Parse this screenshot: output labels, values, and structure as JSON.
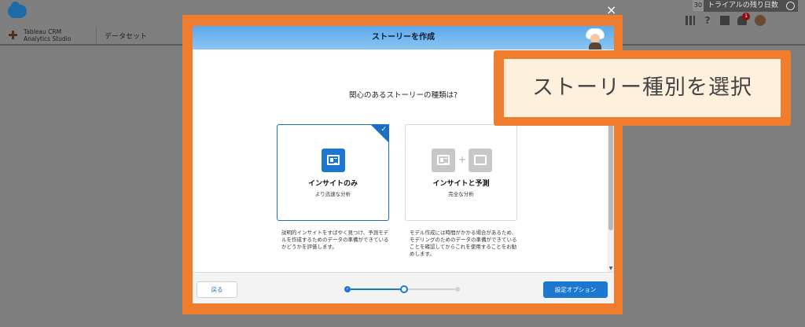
{
  "header": {
    "trial_days": "30",
    "trial_label": "トライアルの残り日数",
    "notification_count": "1",
    "icons": [
      "salesforce-cloud-logo",
      "app-launcher-grid",
      "help-question",
      "setup-gear",
      "notification-bell",
      "user-avatar",
      "clock"
    ]
  },
  "nav": {
    "app_name_line1": "Tableau CRM",
    "app_name_line2": "Analytics Studio",
    "tab_dataset": "データセット"
  },
  "dialog": {
    "close_glyph": "×",
    "title": "ストーリーを作成",
    "question": "関心のあるストーリーの種類は?",
    "options": [
      {
        "title": "インサイトのみ",
        "subtitle": "より迅速な分析",
        "description": "説明的インサイトをすばやく見つけ、予測モデルを作成するためのデータの準備ができているかどうかを評価します。",
        "selected": true
      },
      {
        "title": "インサイトと予測",
        "subtitle": "完全な分析",
        "description": "モデル作成には時間がかかる場合があるため、モデリングのためのデータの準備ができていることを確認してからこれを使用することをお勧めします。",
        "selected": false
      }
    ],
    "check_glyph": "✓",
    "plus_glyph": "+",
    "back_button": "戻る",
    "settings_button": "設定オプション",
    "steps": {
      "total": 3,
      "current": 2,
      "completed_glyph": "✓"
    }
  },
  "callout": {
    "text": "ストーリー種別を選択"
  },
  "colors": {
    "accent_blue": "#1b77d0",
    "annotation_orange": "#f07d2e",
    "callout_fill": "#fdf1dd"
  }
}
